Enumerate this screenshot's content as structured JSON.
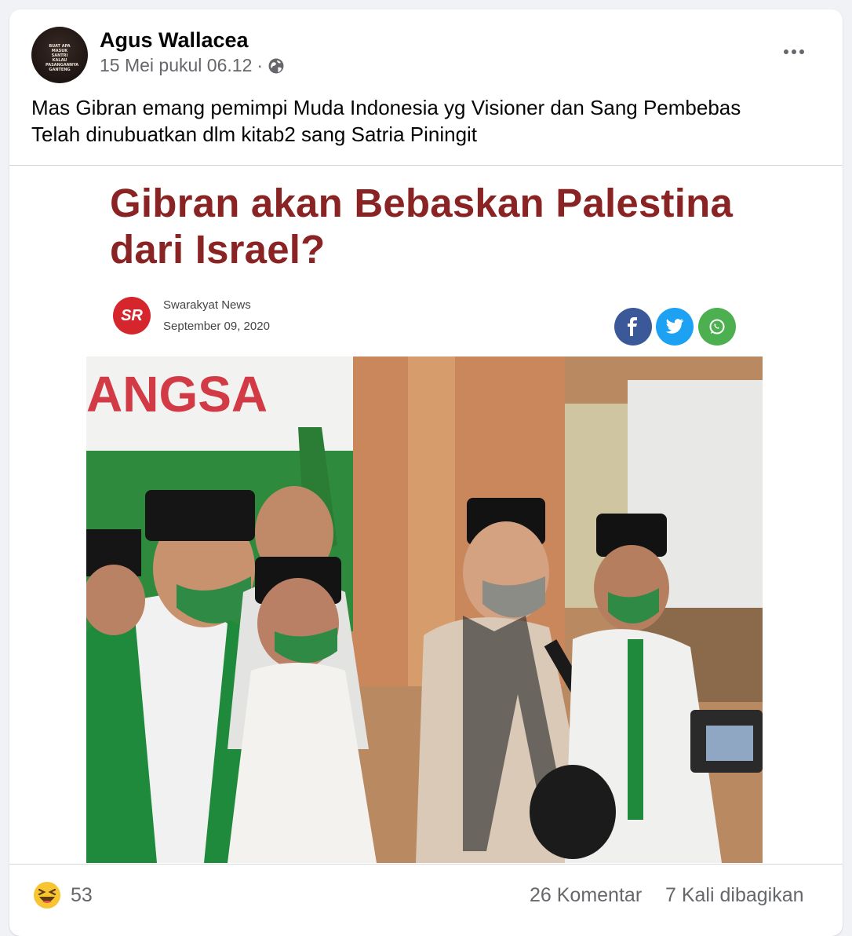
{
  "post": {
    "author": "Agus Wallacea",
    "timestamp": "15 Mei pukul 06.12",
    "separator": "·",
    "privacy_icon": "globe-icon",
    "avatar_shirt_text": "BUAT APA MASUK SANTRI KALAU PASANGANNYA GANTENG",
    "text_line1": "Mas Gibran emang pemimpi Muda Indonesia yg Visioner dan Sang Pembebas",
    "text_line2": "Telah dinubuatkan dlm kitab2 sang Satria Piningit"
  },
  "article": {
    "headline_line1": "Gibran akan Bebaskan Palestina",
    "headline_line2": "dari Israel?",
    "source_logo_text": "SR",
    "source_name": "Swarakyat News",
    "source_date": "September 09, 2020",
    "share_icons": [
      "facebook-icon",
      "twitter-icon",
      "whatsapp-icon"
    ],
    "banner_text": "ANGSA"
  },
  "stats": {
    "reaction_icon": "haha-emoji-icon",
    "reaction_count": "53",
    "comments": "26 Komentar",
    "shares": "7 Kali dibagikan"
  },
  "colors": {
    "headline": "#8a2424",
    "facebook": "#3b5998",
    "twitter": "#1da1f2",
    "whatsapp": "#4caf50",
    "source_logo": "#d4262c",
    "meta_text": "#65676b"
  }
}
